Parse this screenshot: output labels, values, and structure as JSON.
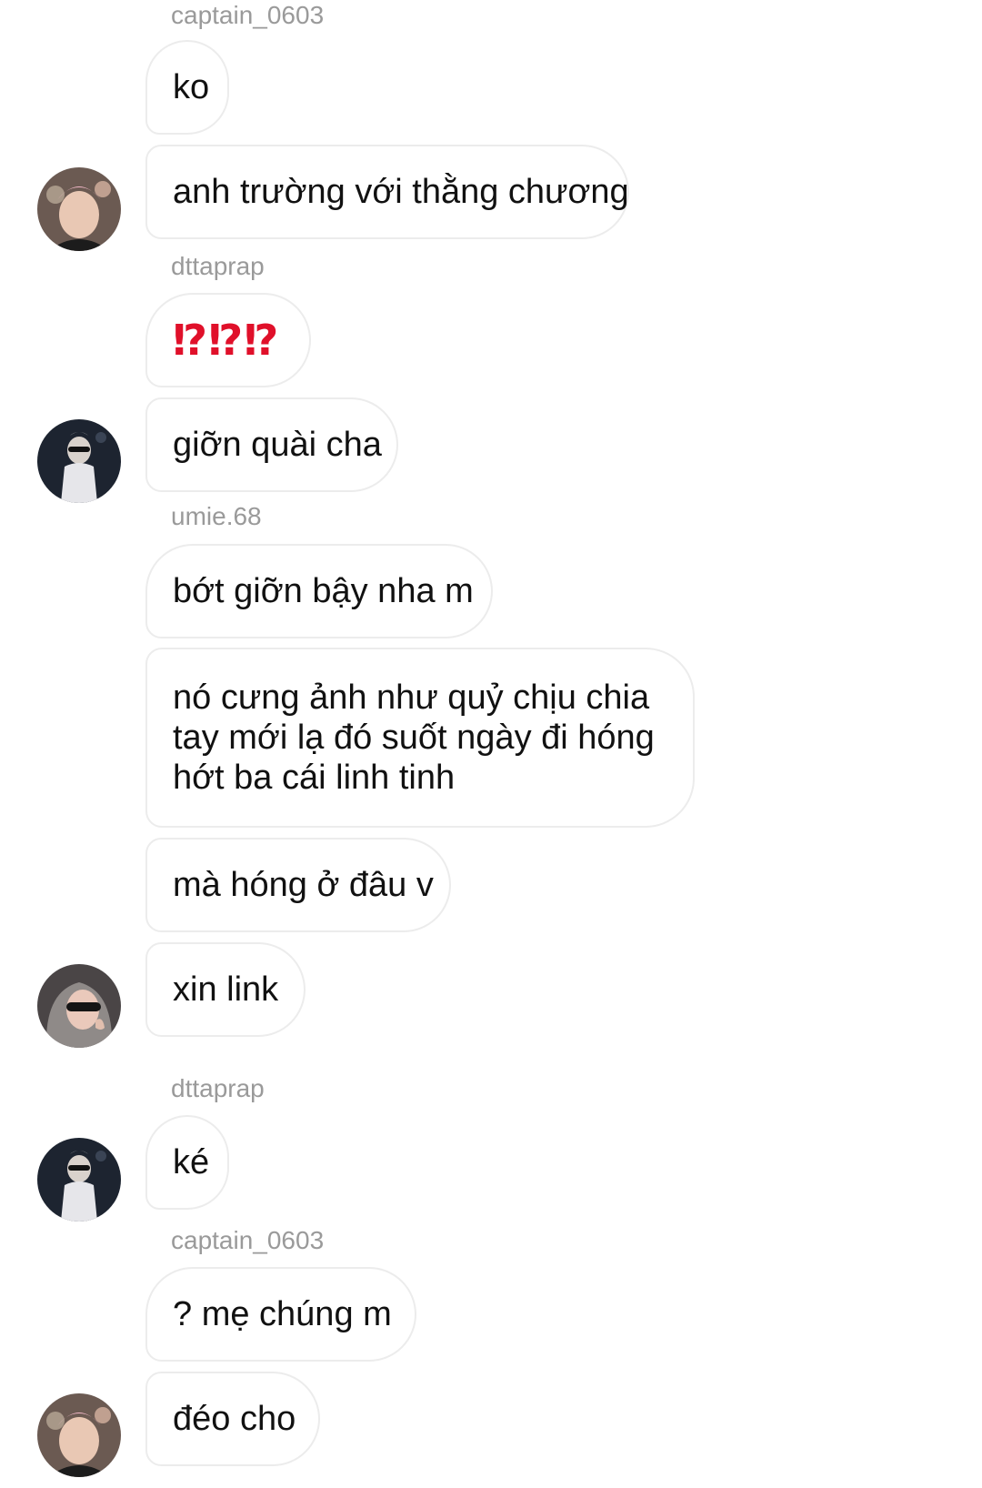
{
  "messages": [
    {
      "sender": "captain_0603",
      "text": "ko"
    },
    {
      "text": "anh trường với thằng chương"
    },
    {
      "sender": "dttaprap",
      "text": "⁉⁉⁉"
    },
    {
      "text": "giỡn quài cha"
    },
    {
      "sender": "umie.68",
      "text": "bớt giỡn bậy nha m"
    },
    {
      "text": "nó cưng ảnh như quỷ chịu chia tay mới lạ đó suốt ngày đi hóng hớt ba cái linh tinh"
    },
    {
      "text": "mà hóng ở đâu v"
    },
    {
      "text": "xin link"
    },
    {
      "sender": "dttaprap",
      "text": "ké"
    },
    {
      "sender": "captain_0603",
      "text": "? mẹ chúng m"
    },
    {
      "text": "đéo cho"
    }
  ],
  "colors": {
    "sender": "#9a9a9a",
    "bubble_border": "#ececec",
    "text": "#111111",
    "emoji_red": "#e0102a"
  }
}
